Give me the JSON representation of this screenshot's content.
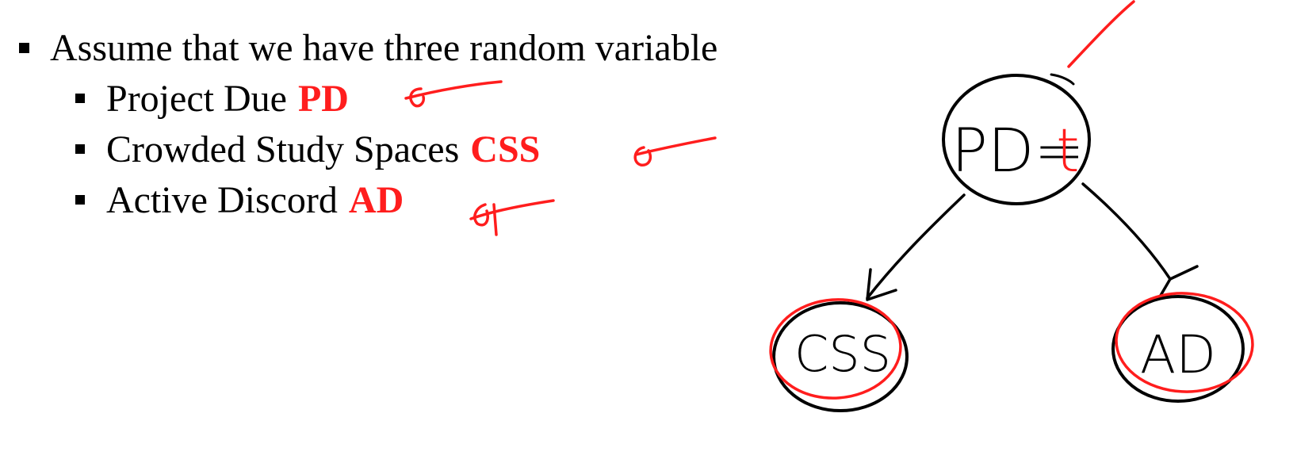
{
  "slide": {
    "bullets": [
      {
        "text": "Assume that we have three random variable",
        "level": 1,
        "abbr": ""
      },
      {
        "text": "Project Due",
        "level": 2,
        "abbr": "PD"
      },
      {
        "text": "Crowded Study Spaces",
        "level": 2,
        "abbr": "CSS"
      },
      {
        "text": "Active Discord",
        "level": 2,
        "abbr": "AD"
      }
    ]
  },
  "diagram": {
    "root_node": {
      "label": "PD=",
      "value": "t"
    },
    "child_left": {
      "label": "CSS"
    },
    "child_right": {
      "label": "AD"
    }
  },
  "colors": {
    "ink": "#000000",
    "annotation": "#ff1d1d"
  }
}
